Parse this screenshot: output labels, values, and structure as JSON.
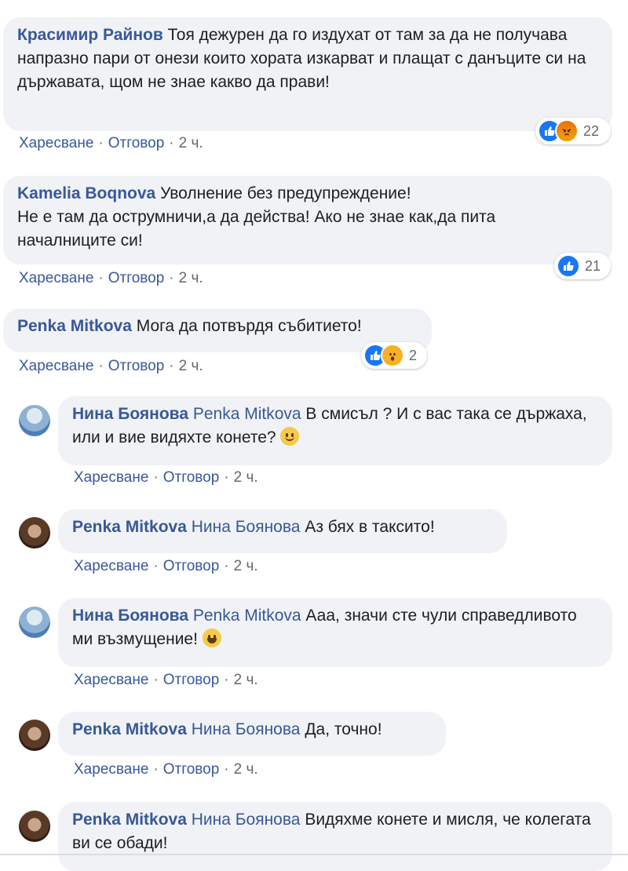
{
  "action_labels": {
    "like": "Харесване",
    "reply": "Отговор",
    "separator": "·"
  },
  "comments": [
    {
      "author": "Красимир Райнов",
      "text": "Тоя дежурен да го издухат от там за да не получава напразно пари от онези които хората изкарват и плащат с данъците си на държавата, щом не знае какво да прави!",
      "time": "2 ч.",
      "reactions": {
        "icons": [
          "like-icon",
          "angry-icon"
        ],
        "count": "22"
      }
    },
    {
      "author": "Kamelia Boqnova",
      "text_line1": "Уволнение без предупреждение!",
      "text_line2": "Не е там да острумничи,а да действа! Ако не знае как,да пита началниците си!",
      "time": "2 ч.",
      "reactions": {
        "icons": [
          "like-icon"
        ],
        "count": "21"
      }
    },
    {
      "author": "Penka Mitkova",
      "text": "Мога да потвърдя събитието!",
      "time": "2 ч.",
      "reactions": {
        "icons": [
          "like-icon",
          "wow-icon"
        ],
        "count": "2"
      }
    }
  ],
  "replies": [
    {
      "author": "Нина Боянова",
      "mention": "Penka Mitkova",
      "text": "В смисъл ? И с вас така се държаха, или и вие видяхте конете?",
      "emoji": "smiling-face-icon",
      "time": "2 ч."
    },
    {
      "author": "Penka Mitkova",
      "mention": "Нина Боянова",
      "text": "Аз бях в таксито!",
      "time": "2 ч."
    },
    {
      "author": "Нина Боянова",
      "mention": "Penka Mitkova",
      "text": "Ааа, значи сте чули справедливото ми възмущение!",
      "emoji": "grinning-face-icon",
      "time": "2 ч."
    },
    {
      "author": "Penka Mitkova",
      "mention": "Нина Боянова",
      "text": "Да, точно!",
      "time": "2 ч."
    },
    {
      "author": "Penka Mitkova",
      "mention": "Нина Боянова",
      "text": "Видяхме конете и мисля, че колегата ви се обади!"
    }
  ],
  "colors": {
    "name": "#385898",
    "bubble": "#f0f2f5",
    "like": "#1877f2",
    "meta": "#65676b"
  }
}
